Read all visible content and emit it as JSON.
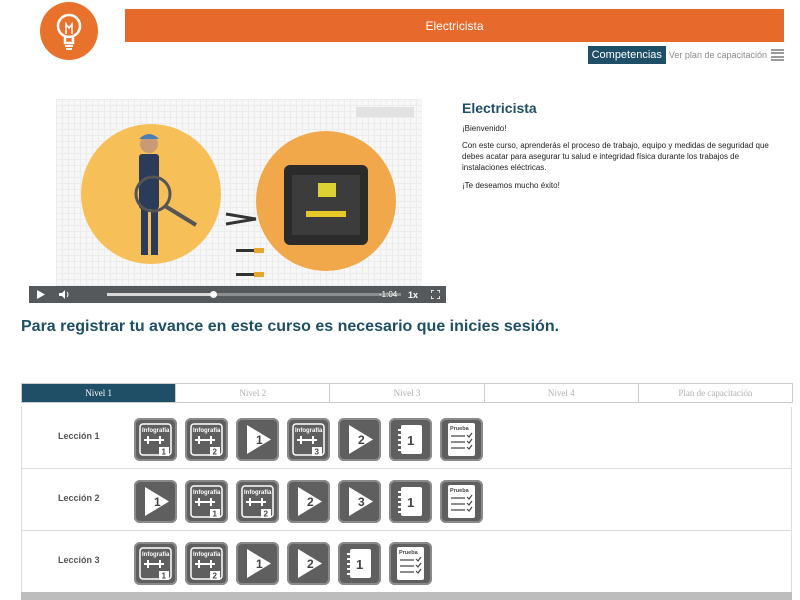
{
  "header": {
    "course_name": "Electricista",
    "logo_icon": "lightbulb-icon",
    "competencias_label": "Competencias",
    "plan_link_label": "Ver plan de capacitación",
    "menu_icon": "menu-icon"
  },
  "video": {
    "time_label": "-1:04",
    "speed_label": "1x",
    "progress": 0.36
  },
  "course": {
    "title": "Electricista",
    "welcome": "¡Bienvenido!",
    "description": "Con este curso, aprenderás el proceso de trabajo, equipo y medidas de seguridad que debes acatar para asegurar tu salud e integridad física durante los trabajos de instalaciones eléctricas.",
    "wish": "¡Te deseamos mucho éxito!"
  },
  "register_message": "Para registrar tu avance en este curso es necesario que inicies sesión.",
  "tabs": [
    "Nivel 1",
    "Nivel 2",
    "Nivel 3",
    "Nivel 4",
    "Plan de capacitación"
  ],
  "icon_texts": {
    "infografia": "Infografía",
    "prueba": "Prueba"
  },
  "lessons": [
    {
      "label": "Lección 1",
      "items": [
        {
          "type": "infografia",
          "num": "1"
        },
        {
          "type": "infografia",
          "num": "2"
        },
        {
          "type": "video",
          "num": "1"
        },
        {
          "type": "infografia",
          "num": "3"
        },
        {
          "type": "video",
          "num": "2"
        },
        {
          "type": "lectura",
          "num": "1"
        },
        {
          "type": "prueba",
          "num": ""
        }
      ]
    },
    {
      "label": "Lección 2",
      "items": [
        {
          "type": "video",
          "num": "1"
        },
        {
          "type": "infografia",
          "num": "1"
        },
        {
          "type": "infografia",
          "num": "2"
        },
        {
          "type": "video",
          "num": "2"
        },
        {
          "type": "video",
          "num": "3"
        },
        {
          "type": "lectura",
          "num": "1"
        },
        {
          "type": "prueba",
          "num": ""
        }
      ]
    },
    {
      "label": "Lección 3",
      "items": [
        {
          "type": "infografia",
          "num": "1"
        },
        {
          "type": "infografia",
          "num": "2"
        },
        {
          "type": "video",
          "num": "1"
        },
        {
          "type": "video",
          "num": "2"
        },
        {
          "type": "lectura",
          "num": "1"
        },
        {
          "type": "prueba",
          "num": ""
        }
      ]
    }
  ]
}
